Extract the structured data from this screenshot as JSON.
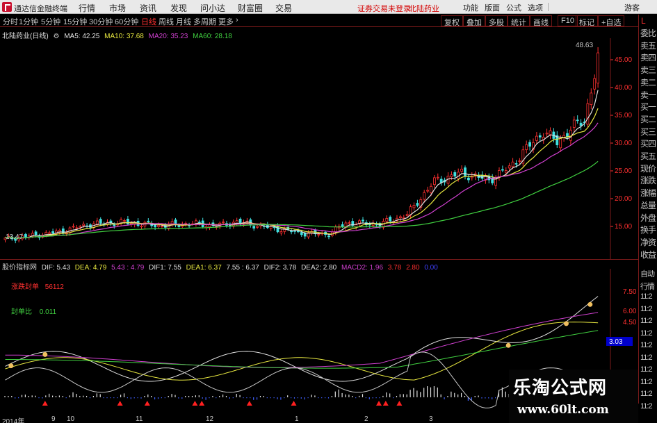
{
  "app": {
    "title": "通达信金融终端",
    "menus": [
      "行情",
      "市场",
      "资讯",
      "发现",
      "问小达",
      "财富圈",
      "交易"
    ],
    "notice": "证券交易未登录",
    "stock_tag": "北陆药业",
    "right_buttons": [
      "功能",
      "版面",
      "公式",
      "选项",
      "游客"
    ]
  },
  "period_bar": {
    "periods": [
      "分时",
      "1分钟",
      "5分钟",
      "15分钟",
      "30分钟",
      "60分钟",
      "日线",
      "周线",
      "月线",
      "多周期",
      "更多"
    ],
    "active": "日线",
    "buttons": [
      "复权",
      "叠加",
      "多股",
      "统计",
      "画线",
      "F10",
      "标记",
      "+自选"
    ]
  },
  "main_chart": {
    "stock_name": "北陆药业(日线)",
    "ma_labels": [
      {
        "text": "MA5: 42.25",
        "color": "#e0e0e0"
      },
      {
        "text": "MA10: 37.68",
        "color": "#e8e840"
      },
      {
        "text": "MA20: 35.23",
        "color": "#d040d0"
      },
      {
        "text": "MA60: 28.18",
        "color": "#40d040"
      }
    ],
    "high_label": "48.63",
    "low_label": "13.47",
    "price_ticks": [
      "45.00",
      "40.00",
      "35.00",
      "30.00",
      "25.00",
      "20.00",
      "15.00"
    ]
  },
  "sub_chart": {
    "indicator_name": "股价指标网",
    "labels": [
      {
        "text": "DIF: 5.43",
        "color": "#e0e0e0"
      },
      {
        "text": "DEA: 4.79",
        "color": "#e8e840"
      },
      {
        "text": "5.43 : 4.79",
        "color": "#d040d0"
      },
      {
        "text": "DIF1: 7.55",
        "color": "#e0e0e0"
      },
      {
        "text": "DEA1: 6.37",
        "color": "#e8e840"
      },
      {
        "text": "7.55 : 6.37",
        "color": "#e0e0e0"
      },
      {
        "text": "DIF2: 3.78",
        "color": "#e0e0e0"
      },
      {
        "text": "DEA2: 2.80",
        "color": "#e0e0e0"
      },
      {
        "text": "MACD2: 1.96",
        "color": "#d040d0"
      },
      {
        "text": "3.78",
        "color": "#ff3030"
      },
      {
        "text": "2.80",
        "color": "#ff3030"
      },
      {
        "text": "0.00",
        "color": "#4040ff"
      }
    ],
    "limit_text": "涨跌封单",
    "limit_value": "56112",
    "seal_text": "封单比",
    "seal_value": "0.011",
    "ticks": [
      "7.50",
      "6.00",
      "4.50",
      "3.03"
    ]
  },
  "quote_panel": {
    "top_letter": "L",
    "items": [
      "委比",
      "卖五",
      "卖四",
      "卖三",
      "卖二",
      "卖一",
      "买一",
      "买二",
      "买三",
      "买四",
      "买五",
      "现价",
      "涨跌",
      "涨幅",
      "总量",
      "外盘",
      "换手",
      "净资",
      "收益"
    ],
    "lower_items": [
      "自动",
      "行情",
      "11:2",
      "11:2",
      "11:2",
      "11:2",
      "11:2",
      "11:2",
      "11:2",
      "11:2",
      "11:2",
      "11:2"
    ]
  },
  "date_axis": [
    "2014年",
    "9",
    "10",
    "11",
    "12",
    "1",
    "2",
    "3"
  ],
  "watermark": {
    "line1": "乐淘公式网",
    "line2": "www.60lt.com"
  },
  "colors": {
    "up": "#ff3030",
    "down": "#40e0e0",
    "ma5": "#e0e0e0",
    "ma10": "#e8e840",
    "ma20": "#d040d0",
    "ma60": "#40d040"
  }
}
